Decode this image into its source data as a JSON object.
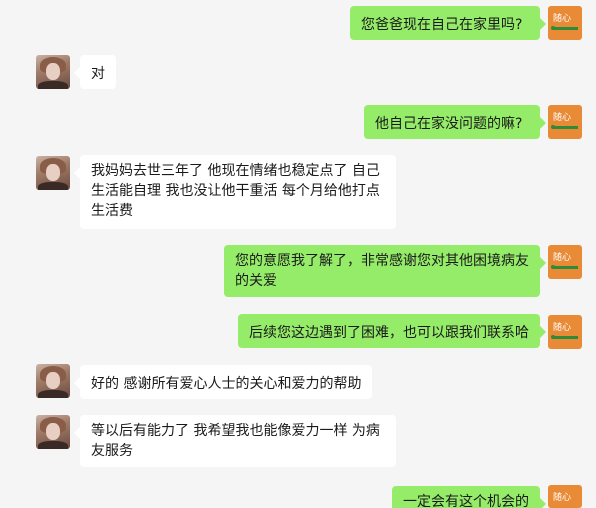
{
  "chat": {
    "me_avatar_text": "随心",
    "messages": [
      {
        "from": "me",
        "text": "您爸爸现在自己在家里吗?"
      },
      {
        "from": "other",
        "text": "对"
      },
      {
        "from": "me",
        "text": "他自己在家没问题的嘛?"
      },
      {
        "from": "other",
        "line1": "我妈妈去世三年了  他现在情绪也稳定点了  自己",
        "line2": "生活能自理  我也没让他干重活  每个月给他打点",
        "line3": "生活费"
      },
      {
        "from": "me",
        "line1": "您的意愿我了解了，非常感谢您对其他困境病友",
        "line2": "的关爱"
      },
      {
        "from": "me",
        "text": "后续您这边遇到了困难，也可以跟我们联系哈"
      },
      {
        "from": "other",
        "text": "好的  感谢所有爱心人士的关心和爱力的帮助"
      },
      {
        "from": "other",
        "line1": "等以后有能力了  我希望我也能像爱力一样  为病",
        "line2": "友服务"
      },
      {
        "from": "me",
        "text": "一定会有这个机会的"
      }
    ]
  },
  "colors": {
    "background": "#f5f5f5",
    "me_bubble": "#95ec69",
    "other_bubble": "#ffffff",
    "me_avatar": "#e98a36"
  }
}
